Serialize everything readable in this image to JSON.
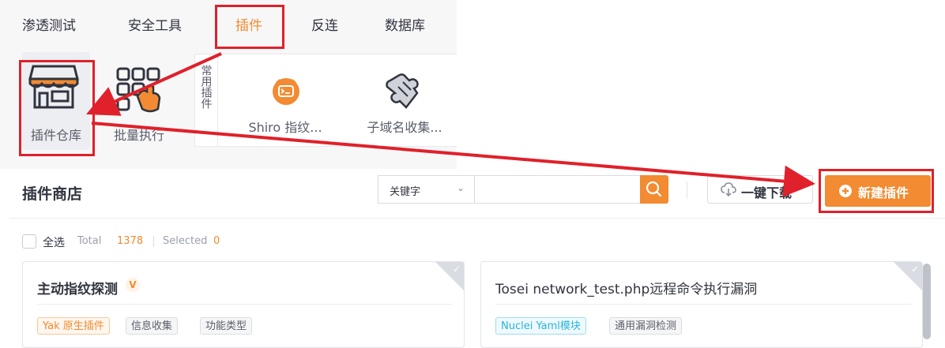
{
  "menu": {
    "tabs": [
      {
        "label": "渗透测试"
      },
      {
        "label": "安全工具"
      },
      {
        "label": "插件"
      },
      {
        "label": "反连"
      },
      {
        "label": "数据库"
      }
    ]
  },
  "tools": {
    "store_label": "插件仓库",
    "batch_label": "批量执行",
    "favorites_label": "常用插件",
    "favorites": [
      {
        "label": "Shiro 指纹..."
      },
      {
        "label": "子域名收集..."
      }
    ]
  },
  "store": {
    "title": "插件商店",
    "search_field_label": "关键字",
    "search_placeholder": "",
    "download_label": "一键下载",
    "new_plugin_label": "新建插件"
  },
  "selection": {
    "select_all_label": "全选",
    "total_label": "Total",
    "total_value": "1378",
    "selected_label": "Selected",
    "selected_value": "0"
  },
  "cards": [
    {
      "title": "主动指纹探测",
      "badge_label": "官方",
      "tags": [
        "Yak 原生插件",
        "信息收集",
        "功能类型"
      ]
    },
    {
      "title": "Tosei network_test.php远程命令执行漏洞",
      "tags": [
        "Nuclei Yaml模块",
        "通用漏洞检测"
      ]
    }
  ],
  "colors": {
    "accent": "#f28b31",
    "annotation_red": "#e0202a",
    "panel_bg": "#f7f7f8"
  }
}
